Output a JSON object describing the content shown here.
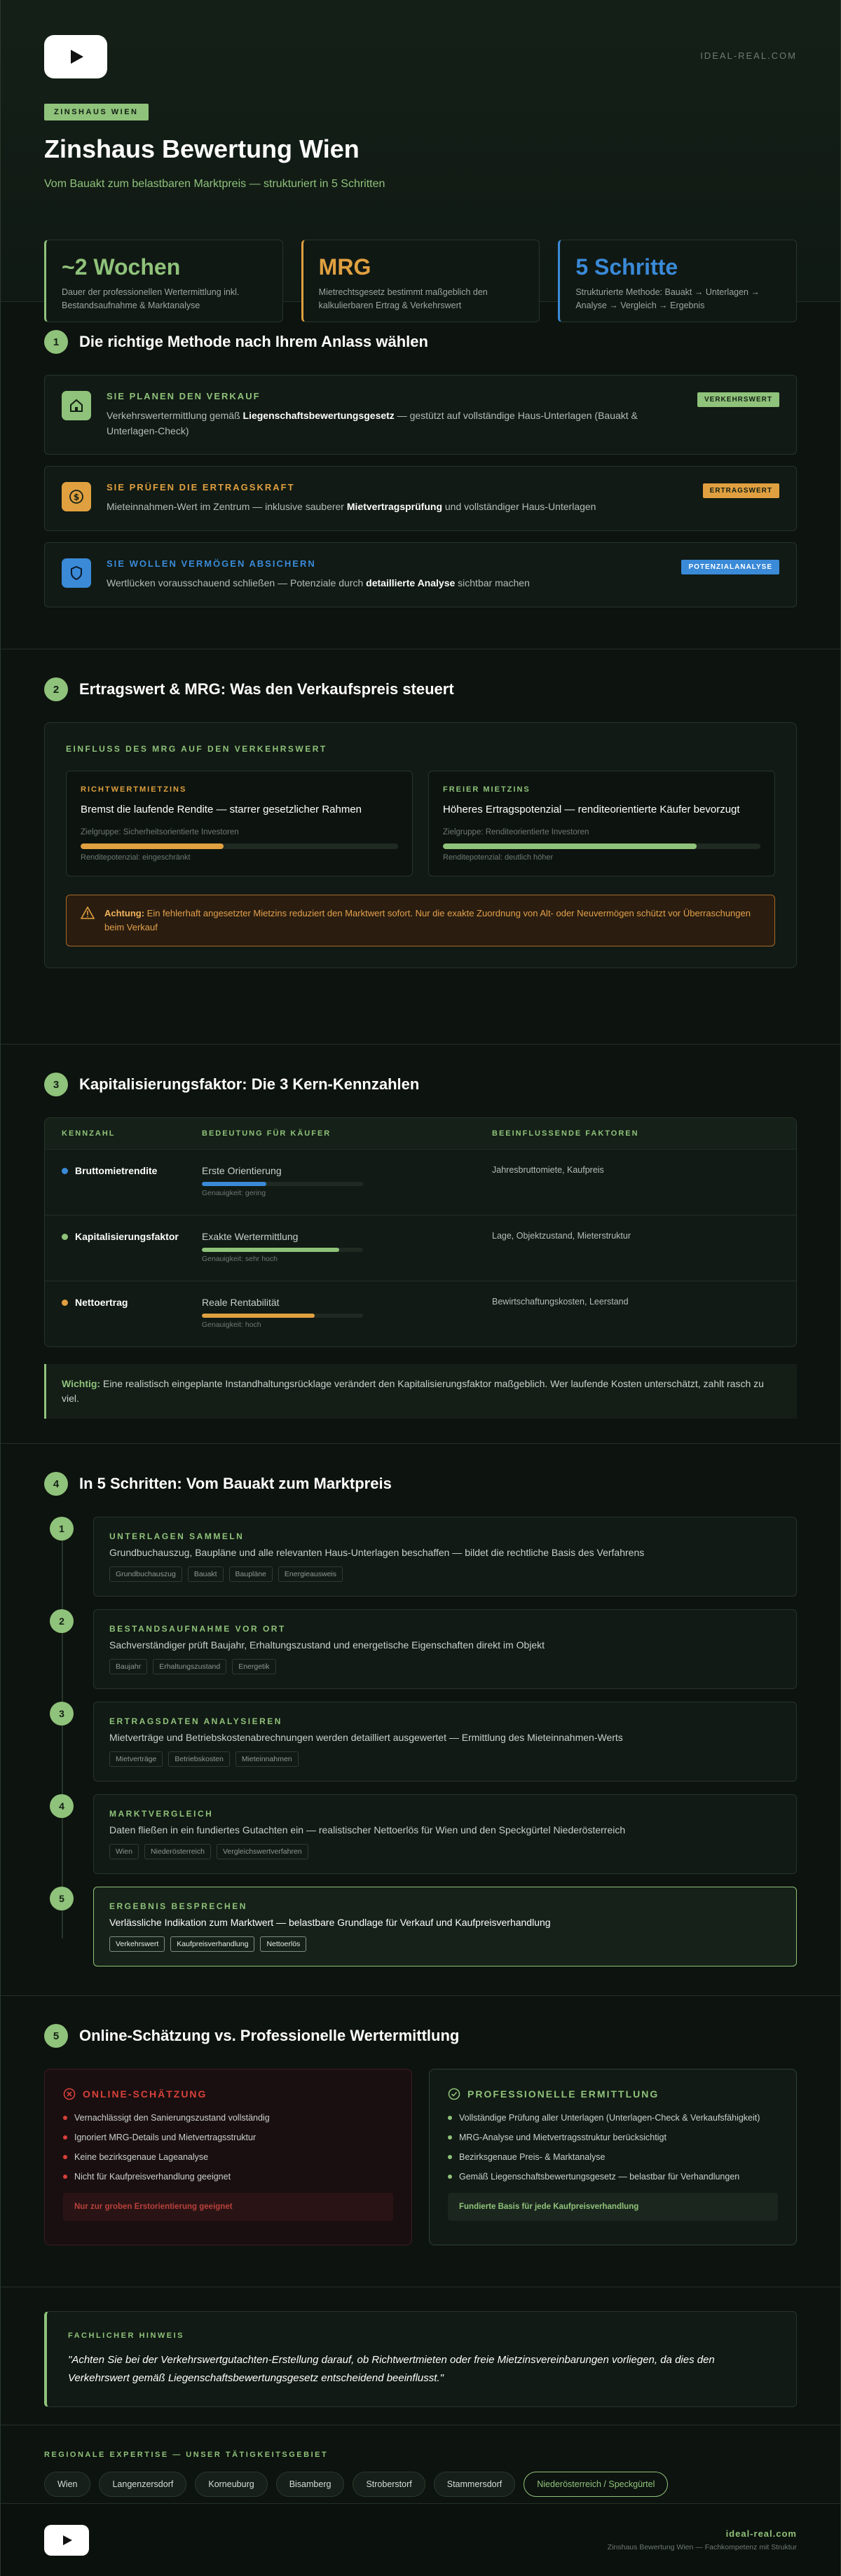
{
  "colors": {
    "green": "#8fc27a",
    "orange": "#e0a040",
    "blue": "#3a8ad8",
    "red": "#d8403a"
  },
  "header": {
    "site": "IDEAL-REAL.COM",
    "tag": "ZINSHAUS WIEN",
    "title": "Zinshaus Bewertung Wien",
    "subtitle": "Vom Bauakt zum belastbaren Marktpreis — strukturiert in 5 Schritten"
  },
  "stats": [
    {
      "big": "~2 Wochen",
      "small": "Dauer der professionellen Wertermittlung inkl. Bestandsaufnahme & Marktanalyse"
    },
    {
      "big": "MRG",
      "small": "Mietrechtsgesetz bestimmt maßgeblich den kalkulierbaren Ertrag & Verkehrswert"
    },
    {
      "big": "5 Schritte",
      "small": "Strukturierte Methode: Bauakt → Unterlagen → Analyse → Vergleich → Ergebnis"
    }
  ],
  "s1": {
    "num": "1",
    "title": "Die richtige Methode nach Ihrem Anlass wählen",
    "cards": [
      {
        "title": "SIE PLANEN DEN VERKAUF",
        "pre": "Verkehrswertermittlung gemäß ",
        "bold": "Liegenschaftsbewertungsgesetz",
        "post": " — gestützt auf vollständige Haus-Unterlagen (Bauakt & Unterlagen-Check)",
        "badge": "VERKEHRSWERT",
        "icon": "home-icon"
      },
      {
        "title": "SIE PRÜFEN DIE ERTRAGSKRAFT",
        "pre": "Mieteinnahmen-Wert im Zentrum — inklusive sauberer ",
        "bold": "Mietvertragsprüfung",
        "post": " und vollständiger Haus-Unterlagen",
        "badge": "ERTRAGSWERT",
        "icon": "dollar-icon"
      },
      {
        "title": "SIE WOLLEN VERMÖGEN ABSICHERN",
        "pre": "Wertlücken vorausschauend schließen — Potenziale durch ",
        "bold": "detaillierte Analyse",
        "post": " sichtbar machen",
        "badge": "POTENZIALANALYSE",
        "icon": "shield-icon"
      }
    ]
  },
  "s2": {
    "num": "2",
    "title": "Ertragswert & MRG: Was den Verkaufspreis steuert",
    "label": "EINFLUSS DES MRG AUF DEN VERKEHRSWERT",
    "left": {
      "t": "RICHTWERTMIETZINS",
      "h": "Bremst die laufende Rendite — starrer gesetzlicher Rahmen",
      "g": "Zielgruppe: Sicherheitsorientierte Investoren",
      "p": "Renditepotenzial: eingeschränkt",
      "level": 0.45
    },
    "right": {
      "t": "FREIER MIETZINS",
      "h": "Höheres Ertragspotenzial — renditeorientierte Käufer bevorzugt",
      "g": "Zielgruppe: Renditeorientierte Investoren",
      "p": "Renditepotenzial: deutlich höher",
      "level": 0.8
    },
    "warn_b": "Achtung:",
    "warn": " Ein fehlerhaft angesetzter Mietzins reduziert den Marktwert sofort. Nur die exakte Zuordnung von Alt- oder Neuvermögen schützt vor Überraschungen beim Verkauf"
  },
  "s3": {
    "num": "3",
    "title": "Kapitalisierungsfaktor: Die 3 Kern-Kennzahlen",
    "head": [
      "KENNZAHL",
      "BEDEUTUNG FÜR KÄUFER",
      "BEEINFLUSSENDE FAKTOREN"
    ],
    "rows": [
      {
        "name": "Bruttomietrendite",
        "mean": "Erste Orientierung",
        "acc": "Genauigkeit: gering",
        "level": 0.4,
        "fac": "Jahresbruttomiete, Kaufpreis"
      },
      {
        "name": "Kapitalisierungsfaktor",
        "mean": "Exakte Wertermittlung",
        "acc": "Genauigkeit: sehr hoch",
        "level": 0.85,
        "fac": "Lage, Objektzustand, Mieterstruktur"
      },
      {
        "name": "Nettoertrag",
        "mean": "Reale Rentabilität",
        "acc": "Genauigkeit: hoch",
        "level": 0.7,
        "fac": "Bewirtschaftungskosten, Leerstand"
      }
    ],
    "note_b": "Wichtig:",
    "note": " Eine realistisch eingeplante Instandhaltungsrücklage verändert den Kapitalisierungsfaktor maßgeblich. Wer laufende Kosten unterschätzt, zahlt rasch zu viel."
  },
  "s4": {
    "num": "4",
    "title": "In 5 Schritten: Vom Bauakt zum Marktpreis",
    "steps": [
      {
        "n": "1",
        "t": "UNTERLAGEN SAMMELN",
        "d": "Grundbuchauszug, Baupläne und alle relevanten Haus-Unterlagen beschaffen — bildet die rechtliche Basis des Verfahrens",
        "chips": [
          "Grundbuchauszug",
          "Bauakt",
          "Baupläne",
          "Energieausweis"
        ]
      },
      {
        "n": "2",
        "t": "BESTANDSAUFNAHME VOR ORT",
        "d": "Sachverständiger prüft Baujahr, Erhaltungszustand und energetische Eigenschaften direkt im Objekt",
        "chips": [
          "Baujahr",
          "Erhaltungszustand",
          "Energetik"
        ]
      },
      {
        "n": "3",
        "t": "ERTRAGSDATEN ANALYSIEREN",
        "d": "Mietverträge und Betriebskostenabrechnungen werden detailliert ausgewertet — Ermittlung des Mieteinnahmen-Werts",
        "chips": [
          "Mietverträge",
          "Betriebskosten",
          "Mieteinnahmen"
        ]
      },
      {
        "n": "4",
        "t": "MARKTVERGLEICH",
        "d": "Daten fließen in ein fundiertes Gutachten ein — realistischer Nettoerlös für Wien und den Speckgürtel Niederösterreich",
        "chips": [
          "Wien",
          "Niederösterreich",
          "Vergleichswertverfahren"
        ]
      },
      {
        "n": "5",
        "t": "ERGEBNIS BESPRECHEN",
        "d": "Verlässliche Indikation zum Marktwert — belastbare Grundlage für Verkauf und Kaufpreisverhandlung",
        "chips": [
          "Verkehrswert",
          "Kaufpreisverhandlung",
          "Nettoerlös"
        ]
      }
    ]
  },
  "s5": {
    "num": "5",
    "title": "Online-Schätzung vs. Professionelle Wertermittlung",
    "bad": {
      "title": "ONLINE-SCHÄTZUNG",
      "items": [
        "Vernachlässigt den Sanierungszustand vollständig",
        "Ignoriert MRG-Details und Mietvertragsstruktur",
        "Keine bezirksgenaue Lageanalyse",
        "Nicht für Kaufpreisverhandlung geeignet"
      ],
      "foot": "Nur zur groben Erstorientierung geeignet"
    },
    "good": {
      "title": "PROFESSIONELLE ERMITTLUNG",
      "items": [
        "Vollständige Prüfung aller Unterlagen (Unterlagen-Check & Verkaufsfähigkeit)",
        "MRG-Analyse und Mietvertragsstruktur berücksichtigt",
        "Bezirksgenaue Preis- & Marktanalyse",
        "Gemäß Liegenschaftsbewertungsgesetz — belastbar für Verhandlungen"
      ],
      "foot": "Fundierte Basis für jede Kaufpreisverhandlung"
    }
  },
  "hint": {
    "label": "FACHLICHER HINWEIS",
    "quote": "\"Achten Sie bei der Verkehrswertgutachten-Erstellung darauf, ob Richtwertmieten oder freie Mietzinsvereinbarungen vorliegen, da dies den Verkehrswert gemäß Liegenschaftsbewertungsgesetz entscheidend beeinflusst.\""
  },
  "regions": {
    "label": "REGIONALE EXPERTISE — UNSER TÄTIGKEITSGEBIET",
    "items": [
      "Wien",
      "Langenzersdorf",
      "Korneuburg",
      "Bisamberg",
      "Stroberstorf",
      "Stammersdorf",
      "Niederösterreich / Speckgürtel"
    ]
  },
  "footer": {
    "domain": "ideal-real.com",
    "sub": "Zinshaus Bewertung Wien — Fachkompetenz mit Struktur"
  }
}
